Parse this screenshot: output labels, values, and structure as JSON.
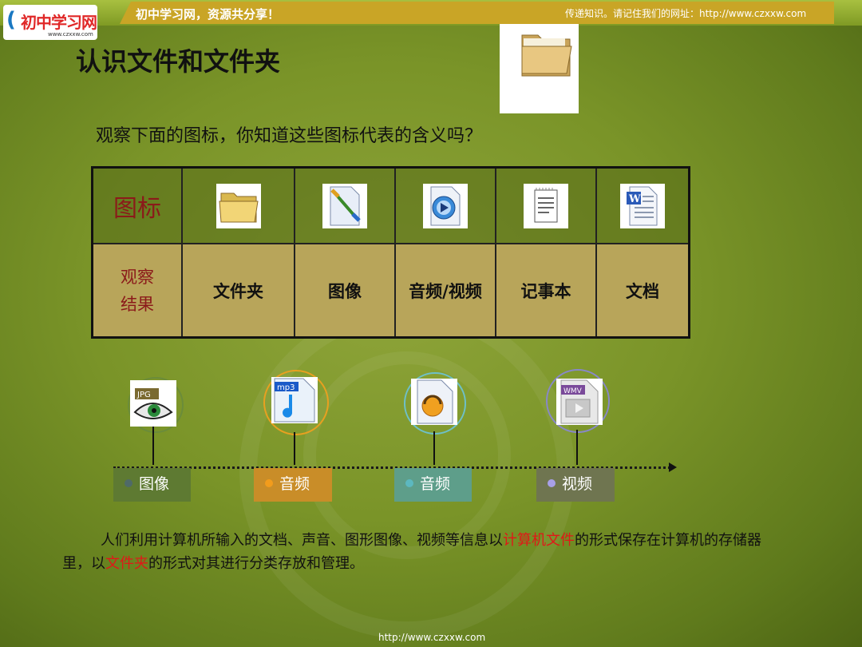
{
  "header": {
    "slogan": "初中学习网，资源共分享！",
    "note": "传递知识。请记住我们的网址：http://www.czxxw.com",
    "logo_text": "初中学习网",
    "logo_url": "www.czxxw.com"
  },
  "title": "认识文件和文件夹",
  "question": "观察下面的图标，你知道这些图标代表的含义吗？",
  "table": {
    "row1_header": "图标",
    "row2_header_line1": "观察",
    "row2_header_line2": "结果",
    "results": [
      "文件夹",
      "图像",
      "音频/视频",
      "记事本",
      "文档"
    ],
    "icons": [
      "folder-icon",
      "paint-image-icon",
      "media-player-icon",
      "notepad-icon",
      "word-document-icon"
    ]
  },
  "timeline": [
    {
      "icon": "jpg-image-icon",
      "badge": "JPG",
      "label": "图像",
      "dot_color": "#4f6a68",
      "tag_bg": "#5e7a32",
      "ring": "#6b8c3a"
    },
    {
      "icon": "mp3-audio-icon",
      "badge": "mp3",
      "label": "音频",
      "dot_color": "#f29c1c",
      "tag_bg": "#c98d28",
      "ring": "#e8a020"
    },
    {
      "icon": "audio-player-icon",
      "badge": "",
      "label": "音频",
      "dot_color": "#5cb8c0",
      "tag_bg": "#5e9e8a",
      "ring": "#6ec0c8"
    },
    {
      "icon": "wmv-video-icon",
      "badge": "WMV",
      "label": "视频",
      "dot_color": "#a8a0e8",
      "tag_bg": "#6f7550",
      "ring": "#8888c8"
    }
  ],
  "paragraph": {
    "part1": "人们利用计算机所输入的文档、声音、图形图像、视频等信息以",
    "highlight1": "计算机文件",
    "part2": "的形式保存在计算机的存储器里，以",
    "highlight2": "文件夹",
    "part3": "的形式对其进行分类存放和管理。"
  },
  "footer": "http://www.czxxw.com"
}
